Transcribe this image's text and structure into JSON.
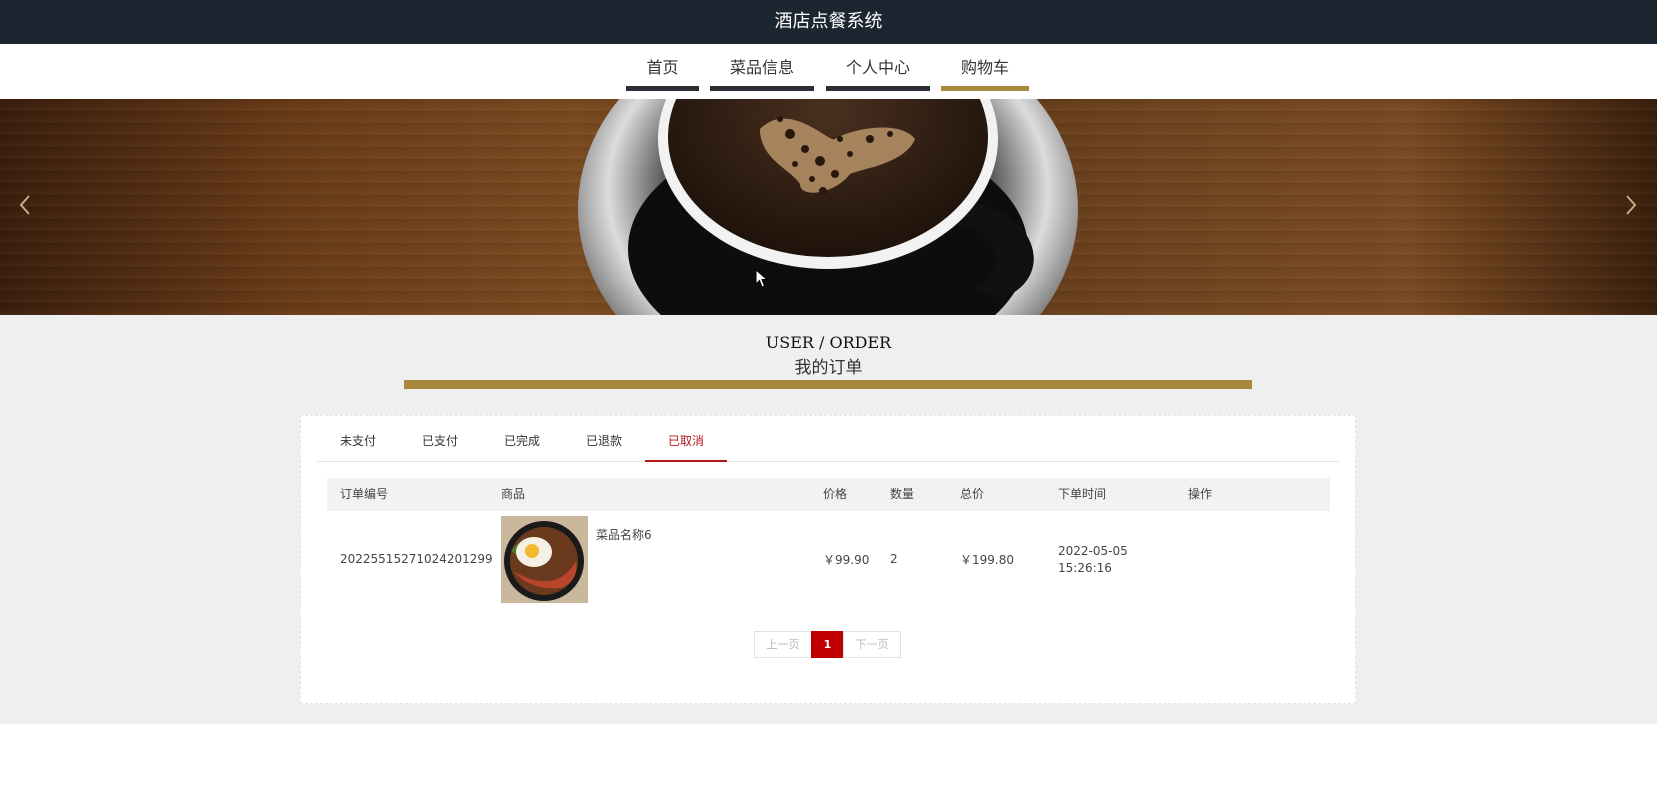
{
  "header": {
    "title": "酒店点餐系统"
  },
  "nav": [
    {
      "label": "首页"
    },
    {
      "label": "菜品信息"
    },
    {
      "label": "个人中心"
    },
    {
      "label": "购物车"
    }
  ],
  "section": {
    "title_en": "USER / ORDER",
    "title_cn": "我的订单"
  },
  "tabs": [
    {
      "label": "未支付"
    },
    {
      "label": "已支付"
    },
    {
      "label": "已完成"
    },
    {
      "label": "已退款"
    },
    {
      "label": "已取消"
    }
  ],
  "table": {
    "headers": [
      "订单编号",
      "商品",
      "价格",
      "数量",
      "总价",
      "下单时间",
      "操作"
    ],
    "rows": [
      {
        "order_no": "20225515271024201299",
        "product_name": "菜品名称6",
        "price": "￥99.90",
        "qty": "2",
        "total": "￥199.80",
        "date": "2022-05-05",
        "time": "15:26:16"
      }
    ]
  },
  "pager": {
    "prev": "上一页",
    "current": "1",
    "next": "下一页"
  },
  "colors": {
    "topbar": "#1c2630",
    "gold": "#a8883a",
    "accent_red": "#c00000"
  },
  "icons": {
    "banner_prev": "chevron-left-icon",
    "banner_next": "chevron-right-icon"
  }
}
